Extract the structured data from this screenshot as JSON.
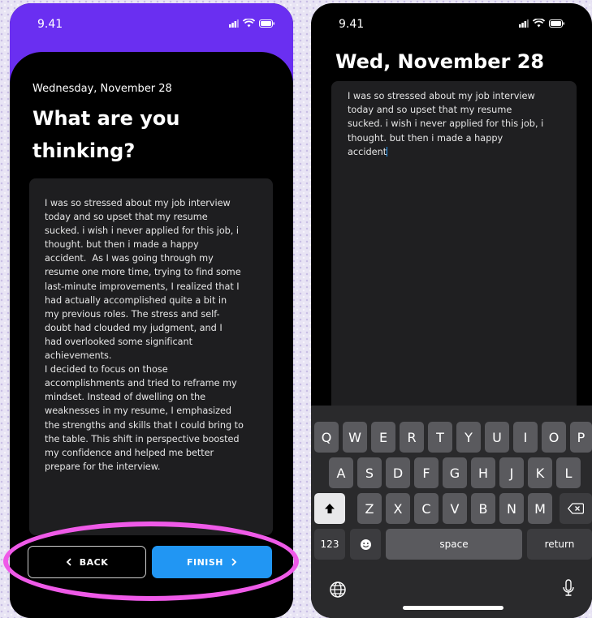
{
  "phone1": {
    "status_time": "9.41",
    "date": "Wednesday,  November 28",
    "title": "What are you thinking?",
    "entry_text": "I was so stressed about my job interview\ntoday and so upset that my resume\nsucked. i wish i never applied for this job, i\nthought. but then i made a happy\naccident.  As I was going through my\nresume one more time, trying to find some\nlast-minute improvements, I realized that I\nhad actually accomplished quite a bit in\nmy previous roles. The stress and self-\ndoubt had clouded my judgment, and I\nhad overlooked some significant\nachievements.\nI decided to focus on those\naccomplishments and tried to reframe my\nmindset. Instead of dwelling on the\nweaknesses in my resume, I emphasized\nthe strengths and skills that I could bring to\nthe table. This shift in perspective boosted\nmy confidence and helped me better\nprepare for the interview.",
    "back_label": "BACK",
    "finish_label": "FINISH",
    "colors": {
      "header": "#6a2ff1",
      "finish": "#2196f3",
      "highlight": "#ef5ae8"
    }
  },
  "phone2": {
    "status_time": "9.41",
    "title": "Wed, November 28",
    "entry_text": "I was so stressed about my job interview\ntoday and so upset that my resume\nsucked. i wish i never applied for this job, i\nthought. but then i made a happy\naccident",
    "keyboard": {
      "row1": [
        "Q",
        "W",
        "E",
        "R",
        "T",
        "Y",
        "U",
        "I",
        "O",
        "P"
      ],
      "row2": [
        "A",
        "S",
        "D",
        "F",
        "G",
        "H",
        "J",
        "K",
        "L"
      ],
      "row3": [
        "Z",
        "X",
        "C",
        "V",
        "B",
        "N",
        "M"
      ],
      "numbers_key": "123",
      "space_key": "space",
      "return_key": "return"
    }
  }
}
